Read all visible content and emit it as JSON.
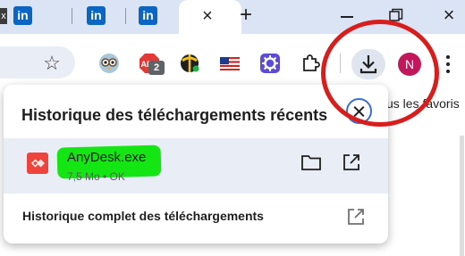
{
  "tabs": [
    {
      "favicon": "linkedin-icon",
      "glyph": "in"
    },
    {
      "favicon": "linkedin-icon",
      "glyph": "in"
    },
    {
      "favicon": "linkedin-icon",
      "glyph": "in"
    }
  ],
  "window": {
    "new_tab": "+",
    "close_tab": "×",
    "close_window": "×"
  },
  "toolbar": {
    "star": "☆",
    "extension_badge": "2",
    "profile_initial": "N",
    "accent": "#c2185b"
  },
  "page": {
    "bookmarks_hint": "us les favoris"
  },
  "downloads": {
    "title": "Historique des téléchargements récents",
    "items": [
      {
        "name": "AnyDesk.exe",
        "status": "7,5 Mo • OK",
        "icon": "anydesk-icon",
        "highlight_color": "#13e613"
      }
    ],
    "full_history": "Historique complet des téléchargements"
  },
  "annotation": {
    "circle_color": "#d91c1c"
  }
}
